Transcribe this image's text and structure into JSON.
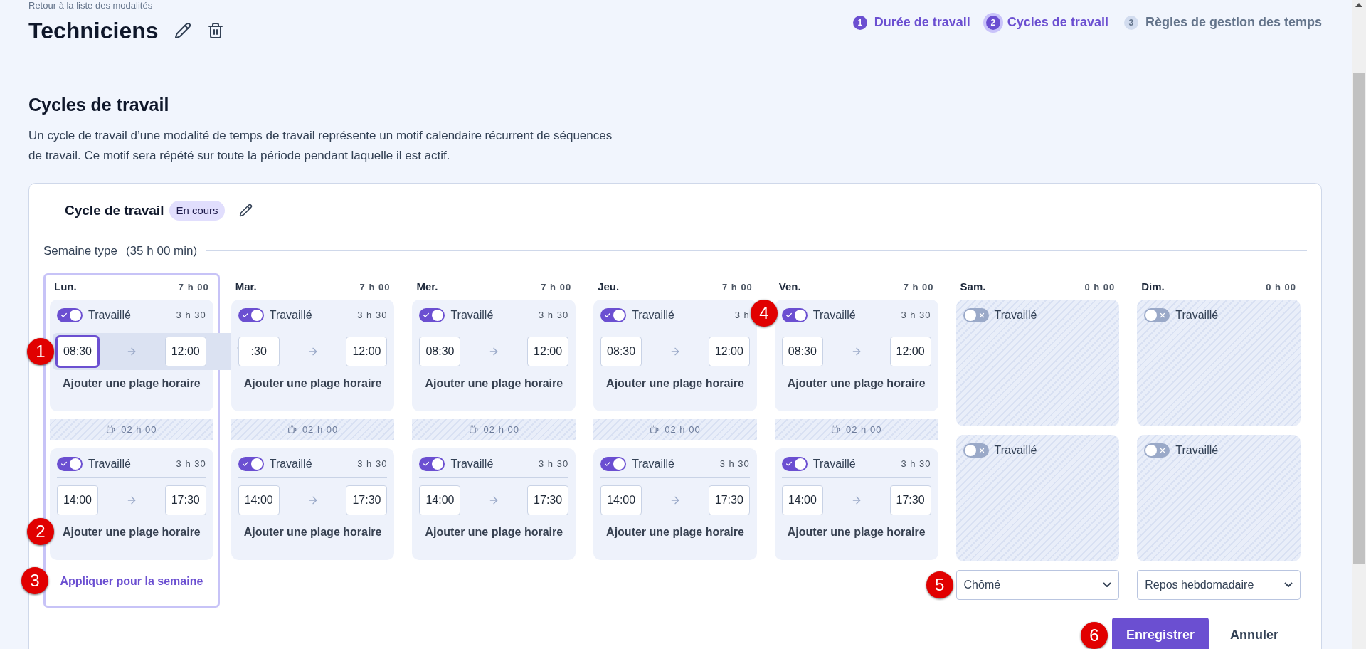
{
  "back_link": "Retour à la liste des modalités",
  "title": "Techniciens",
  "steps": [
    {
      "number": "1",
      "label": "Durée de travail",
      "reached": true,
      "selected": false
    },
    {
      "number": "2",
      "label": "Cycles de travail",
      "reached": true,
      "selected": true
    },
    {
      "number": "3",
      "label": "Règles de gestion des temps",
      "reached": false,
      "selected": false
    }
  ],
  "section": {
    "heading": "Cycles de travail",
    "description": "Un cycle de travail d’une modalité de temps de travail représente un motif calendaire récurrent de séquences de travail. Ce motif sera répété sur toute la période pendant laquelle il est actif."
  },
  "cycle": {
    "title": "Cycle de travail",
    "badge": "En cours",
    "week_label": "Semaine type",
    "week_total": "(35 h 00 min)",
    "days": [
      {
        "name": "Lun.",
        "total": "7 h 00",
        "selected": true,
        "break": "02 h 00",
        "apply_link": "Appliquer pour la semaine",
        "apply_callout": "3",
        "slots": [
          {
            "on": true,
            "label": "Travaillé",
            "duration": "3 h 30",
            "start": "08:30",
            "end": "12:00",
            "hovered": true,
            "focused": true,
            "callout": "1",
            "add_label": "Ajouter une plage horaire"
          },
          {
            "on": true,
            "label": "Travaillé",
            "duration": "3 h 30",
            "start": "14:00",
            "end": "17:30",
            "hovered": false,
            "focused": false,
            "add_label": "Ajouter une plage horaire",
            "add_callout": "2"
          }
        ]
      },
      {
        "name": "Mar.",
        "total": "7 h 00",
        "selected": false,
        "break": "02 h 00",
        "slots": [
          {
            "on": true,
            "label": "Travaillé",
            "duration": "3 h 30",
            "start": ":30",
            "end": "12:00",
            "hovered": false,
            "focused": false,
            "add_label": "Ajouter une plage horaire"
          },
          {
            "on": true,
            "label": "Travaillé",
            "duration": "3 h 30",
            "start": "14:00",
            "end": "17:30",
            "hovered": false,
            "focused": false,
            "add_label": "Ajouter une plage horaire"
          }
        ]
      },
      {
        "name": "Mer.",
        "total": "7 h 00",
        "selected": false,
        "break": "02 h 00",
        "slots": [
          {
            "on": true,
            "label": "Travaillé",
            "duration": "3 h 30",
            "start": "08:30",
            "end": "12:00",
            "hovered": false,
            "focused": false,
            "add_label": "Ajouter une plage horaire"
          },
          {
            "on": true,
            "label": "Travaillé",
            "duration": "3 h 30",
            "start": "14:00",
            "end": "17:30",
            "hovered": false,
            "focused": false,
            "add_label": "Ajouter une plage horaire"
          }
        ]
      },
      {
        "name": "Jeu.",
        "total": "7 h 00",
        "selected": false,
        "break": "02 h 00",
        "slots": [
          {
            "on": true,
            "label": "Travaillé",
            "duration": "3 h",
            "start": "08:30",
            "end": "12:00",
            "hovered": false,
            "focused": false,
            "add_label": "Ajouter une plage horaire"
          },
          {
            "on": true,
            "label": "Travaillé",
            "duration": "3 h 30",
            "start": "14:00",
            "end": "17:30",
            "hovered": false,
            "focused": false,
            "add_label": "Ajouter une plage horaire"
          }
        ]
      },
      {
        "name": "Ven.",
        "total": "7 h 00",
        "selected": false,
        "break": "02 h 00",
        "slots": [
          {
            "on": true,
            "label": "Travaillé",
            "duration": "3 h 30",
            "start": "08:30",
            "end": "12:00",
            "hovered": false,
            "focused": false,
            "callout": "4",
            "add_label": "Ajouter une plage horaire"
          },
          {
            "on": true,
            "label": "Travaillé",
            "duration": "3 h 30",
            "start": "14:00",
            "end": "17:30",
            "hovered": false,
            "focused": false,
            "add_label": "Ajouter une plage horaire"
          }
        ]
      },
      {
        "name": "Sam.",
        "total": "0 h 00",
        "selected": false,
        "rest_type": "Chômé",
        "rest_callout": "5",
        "slots": [
          {
            "on": false,
            "label": "Travaillé"
          },
          {
            "on": false,
            "label": "Travaillé"
          }
        ]
      },
      {
        "name": "Dim.",
        "total": "0 h 00",
        "selected": false,
        "rest_type": "Repos hebdomadaire",
        "slots": [
          {
            "on": false,
            "label": "Travaillé"
          },
          {
            "on": false,
            "label": "Travaillé"
          }
        ]
      }
    ],
    "save_button": "Enregistrer",
    "save_callout": "6",
    "cancel_button": "Annuler"
  }
}
